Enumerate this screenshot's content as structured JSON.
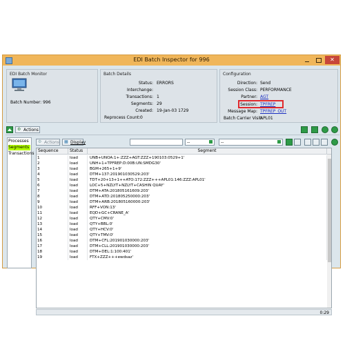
{
  "window": {
    "title": "EDI Batch Inspector for 996",
    "close_glyph": "✕"
  },
  "monitor": {
    "title": "EDI Batch Monitor",
    "batch_number_label": "Batch Number:",
    "batch_number": "996"
  },
  "details": {
    "title": "Batch Details",
    "fields": [
      {
        "label": "Status:",
        "value": "ERRORS"
      },
      {
        "label": "Interchange:",
        "value": ""
      },
      {
        "label": "Transactions:",
        "value": "1"
      },
      {
        "label": "Segments:",
        "value": "29"
      },
      {
        "label": "Created:",
        "value": "19-Jan-03 1729"
      },
      {
        "label": "Reprocess Count:",
        "value": "0"
      }
    ]
  },
  "config": {
    "title": "Configuration",
    "fields": [
      {
        "label": "Direction:",
        "value": "Send"
      },
      {
        "label": "Session Class:",
        "value": "PERFORMANCE"
      },
      {
        "label": "Partner:",
        "value": "AGT"
      },
      {
        "label": "Session:",
        "value": "TPFREP"
      },
      {
        "label": "Message Map:",
        "value": "TPFREP_OUT"
      },
      {
        "label": "Batch Carrier Visit:",
        "value": "APL01"
      }
    ]
  },
  "toolbar": {
    "actions_label": "Actions",
    "actions2_label": "Actions",
    "display_label": "Display",
    "combo1": "--",
    "combo2": "--"
  },
  "sidebar": {
    "items": [
      "Processes",
      "Segments",
      "Transactions"
    ]
  },
  "table": {
    "columns": [
      "Sequence",
      "Status",
      "Segment"
    ],
    "rows": [
      [
        "1",
        "load",
        "UNB+UNOA:1+:ZZZ+AGT:ZZZ+190103:0529+1'"
      ],
      [
        "2",
        "load",
        "UNH+1+TPFREP:D:00B:UN:SMDG30'"
      ],
      [
        "3",
        "load",
        "BGM+265+1+9'"
      ],
      [
        "4",
        "load",
        "DTM+137:201901030529:203'"
      ],
      [
        "5",
        "load",
        "TDT+20+13+1++ATO:172:ZZZ+++APL01:146:ZZZ:APL01'"
      ],
      [
        "6",
        "load",
        "LOC+5+NZLYT+NZLYT+CASHIN QUAY'"
      ],
      [
        "7",
        "load",
        "DTM+ATA:201805161609:203'"
      ],
      [
        "8",
        "load",
        "DTM+ATD:201805250000:203'"
      ],
      [
        "9",
        "load",
        "DTM+ARB:201805160000:203'"
      ],
      [
        "10",
        "load",
        "RFF+VON:13'"
      ],
      [
        "11",
        "load",
        "EQD+GC+CRANE_A'"
      ],
      [
        "12",
        "load",
        "QTY+CMV:0'"
      ],
      [
        "13",
        "load",
        "QTY+BBL:0'"
      ],
      [
        "14",
        "load",
        "QTY+HCV:0'"
      ],
      [
        "15",
        "load",
        "QTY+TMV:0'"
      ],
      [
        "16",
        "load",
        "DTM+CFL:201901030000:203'"
      ],
      [
        "17",
        "load",
        "DTM+CLL:201901030000:203'"
      ],
      [
        "18",
        "load",
        "DTM+DEL:1:100:401'"
      ],
      [
        "19",
        "load",
        "FTX+ZZZ+++ewdsaz'"
      ]
    ]
  },
  "status_bar": {
    "clock": "0:29"
  },
  "colors": {
    "titlebar": "#f0b65a",
    "window_bg": "#dce6ec",
    "selection": "#b3ff00",
    "highlight_box": "#e0282c",
    "link": "#1a2ec0"
  }
}
